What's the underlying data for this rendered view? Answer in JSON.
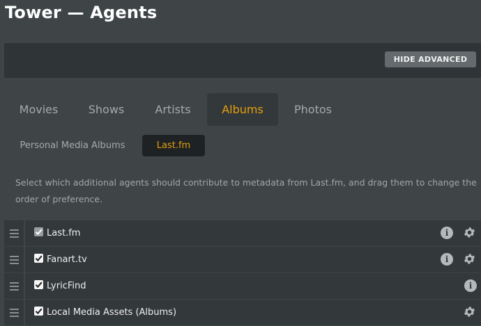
{
  "window": {
    "title": "Tower — Agents"
  },
  "toolbar": {
    "hide_advanced_label": "HIDE ADVANCED"
  },
  "tabs": [
    {
      "label": "Movies",
      "active": false
    },
    {
      "label": "Shows",
      "active": false
    },
    {
      "label": "Artists",
      "active": false
    },
    {
      "label": "Albums",
      "active": true
    },
    {
      "label": "Photos",
      "active": false
    }
  ],
  "subtabs": [
    {
      "label": "Personal Media Albums",
      "active": false
    },
    {
      "label": "Last.fm",
      "active": true
    }
  ],
  "description": "Select which additional agents should contribute to metadata from Last.fm, and drag them to change the order of preference.",
  "agents": [
    {
      "name": "Last.fm",
      "checked": true,
      "disabled": true,
      "info_icon": "info-icon",
      "settings_icon": "gear-icon"
    },
    {
      "name": "Fanart.tv",
      "checked": true,
      "disabled": false,
      "info_icon": "info-icon",
      "settings_icon": "gear-icon"
    },
    {
      "name": "LyricFind",
      "checked": true,
      "disabled": false,
      "info_icon": "info-icon",
      "settings_icon": null
    },
    {
      "name": "Local Media Assets (Albums)",
      "checked": true,
      "disabled": false,
      "info_icon": null,
      "settings_icon": "gear-icon"
    }
  ],
  "icons": {
    "info_glyph": "i"
  },
  "colors": {
    "accent": "#e5a00d",
    "background": "#3f4547",
    "panel": "#33383a",
    "toolbar": "#2f3436"
  }
}
